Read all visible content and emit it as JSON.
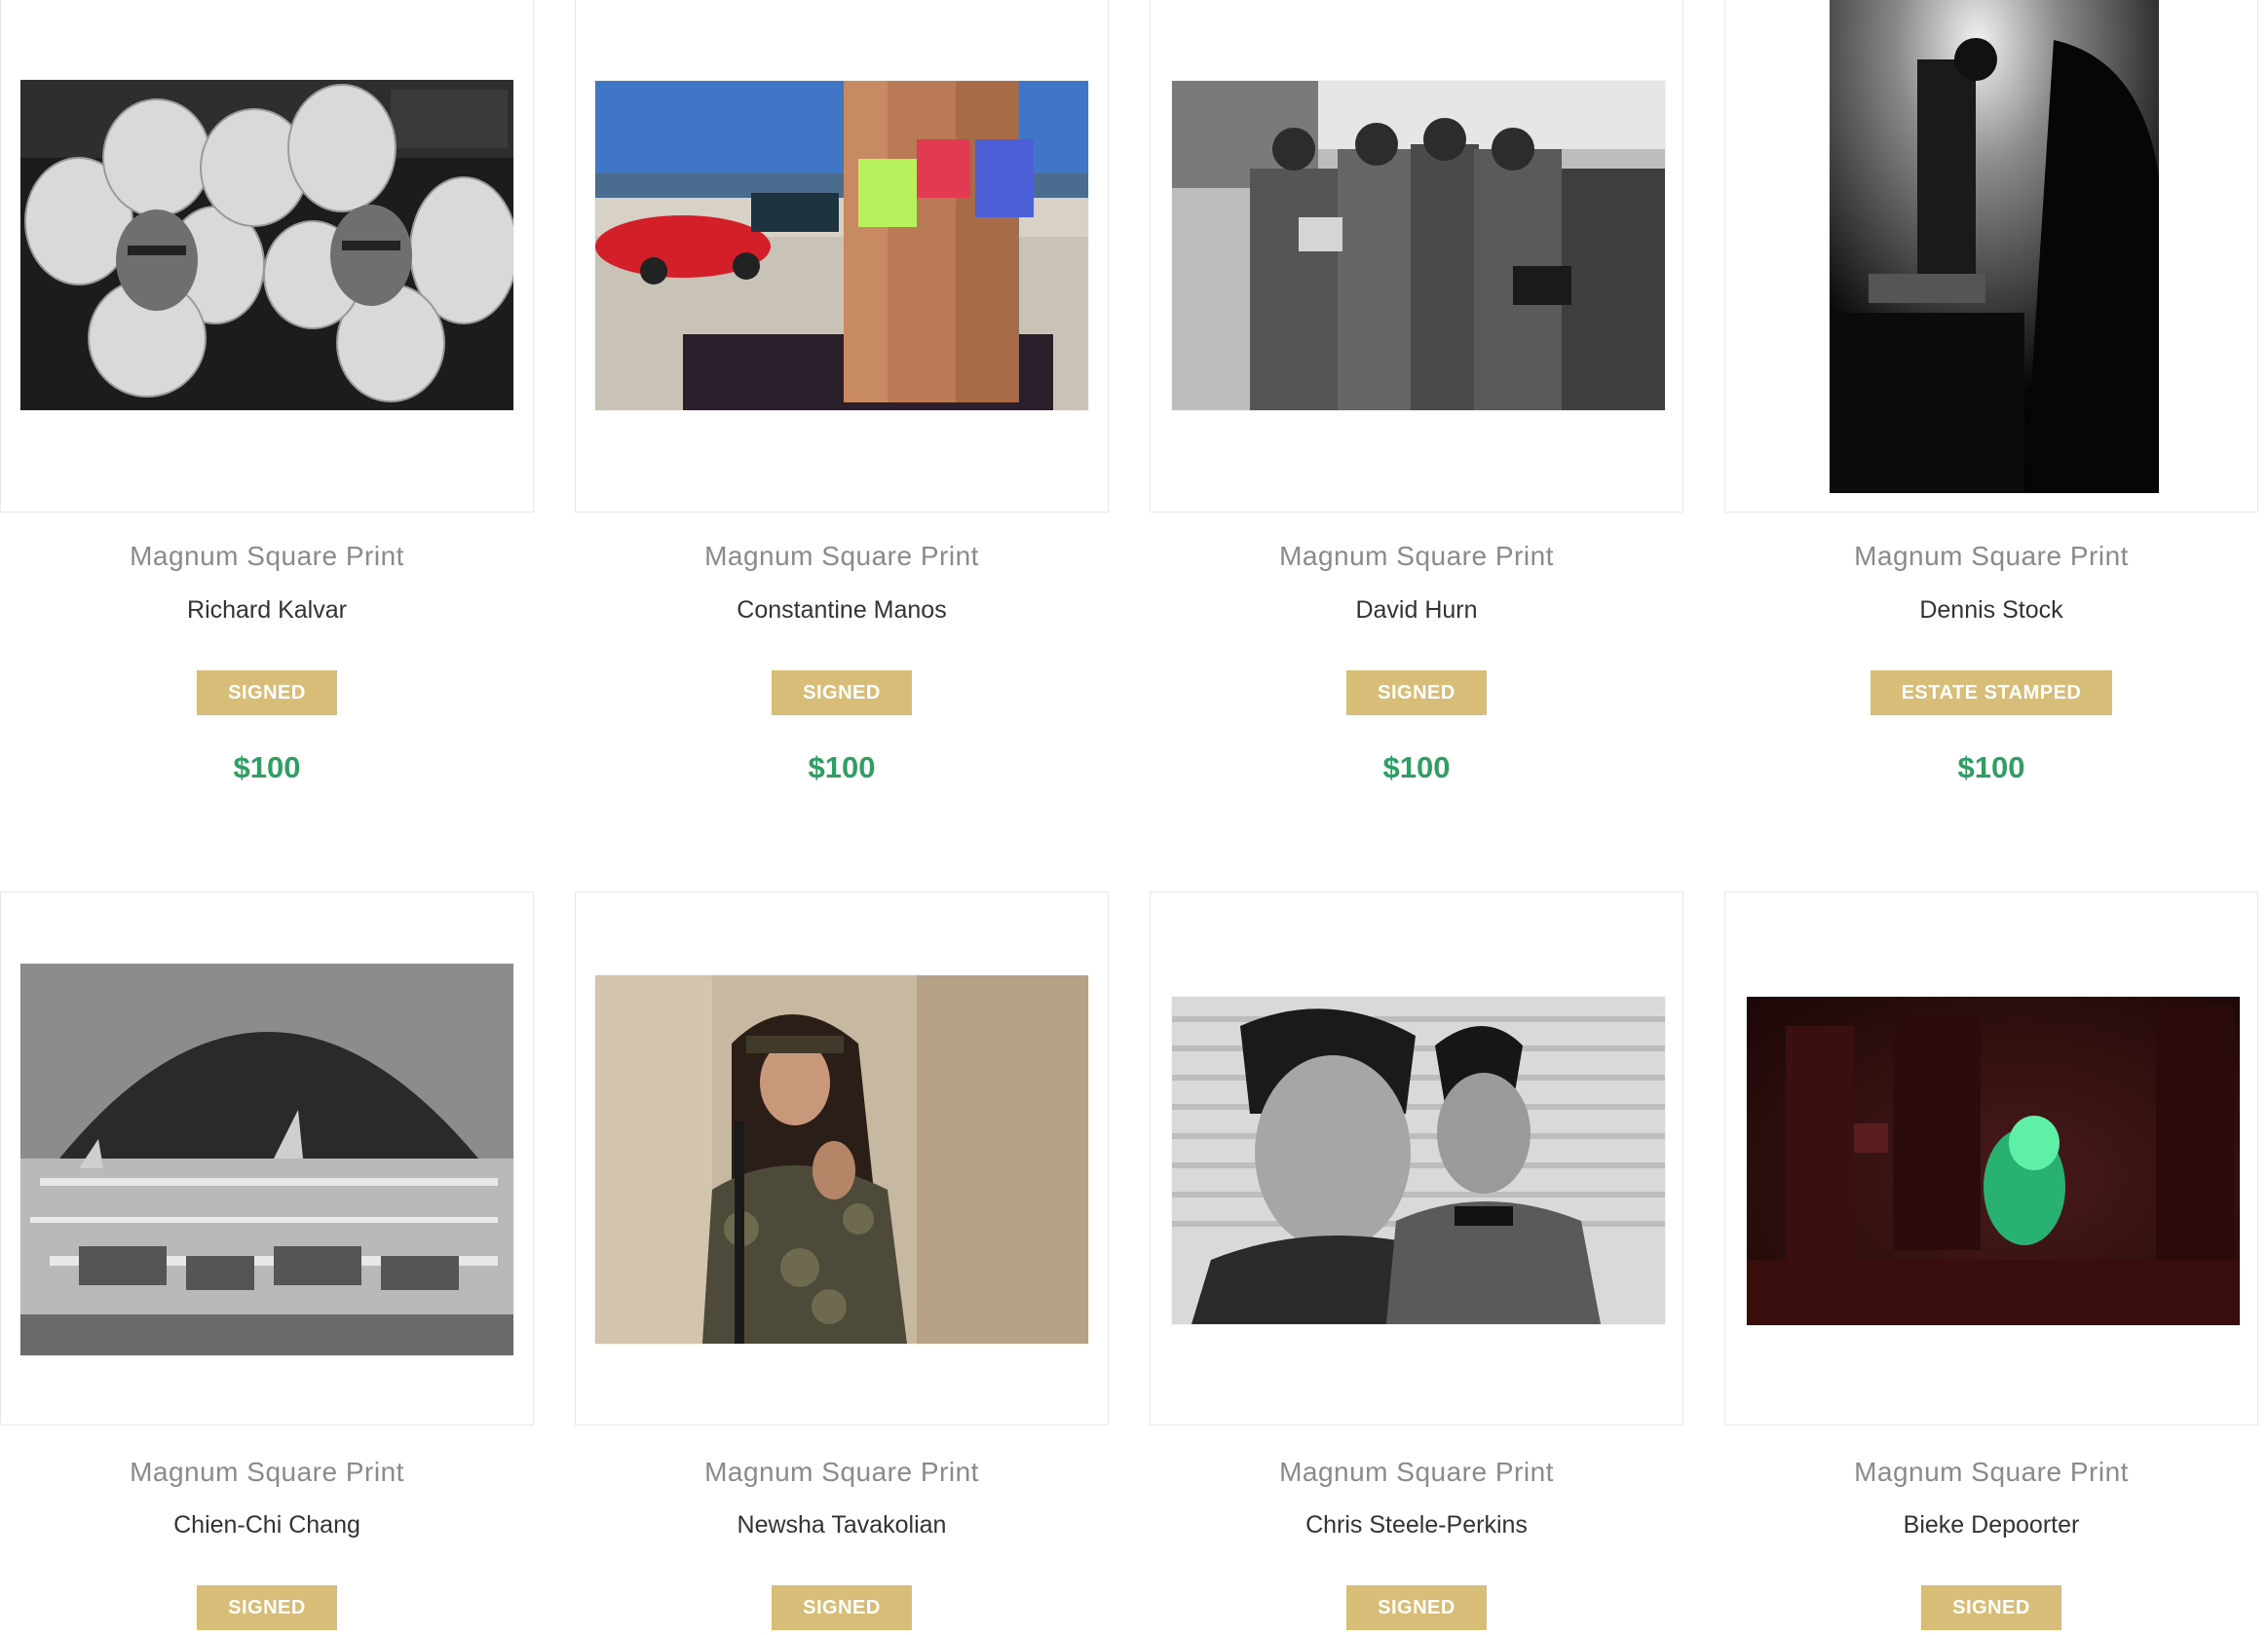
{
  "products": [
    {
      "type": "Magnum Square Print",
      "artist": "Richard Kalvar",
      "badge": "SIGNED",
      "price": "$100"
    },
    {
      "type": "Magnum Square Print",
      "artist": "Constantine Manos",
      "badge": "SIGNED",
      "price": "$100"
    },
    {
      "type": "Magnum Square Print",
      "artist": "David Hurn",
      "badge": "SIGNED",
      "price": "$100"
    },
    {
      "type": "Magnum Square Print",
      "artist": "Dennis Stock",
      "badge": "ESTATE STAMPED",
      "price": "$100"
    },
    {
      "type": "Magnum Square Print",
      "artist": "Chien-Chi Chang",
      "badge": "SIGNED",
      "price": ""
    },
    {
      "type": "Magnum Square Print",
      "artist": "Newsha Tavakolian",
      "badge": "SIGNED",
      "price": ""
    },
    {
      "type": "Magnum Square Print",
      "artist": "Chris Steele-Perkins",
      "badge": "SIGNED",
      "price": ""
    },
    {
      "type": "Magnum Square Print",
      "artist": "Bieke Depoorter",
      "badge": "SIGNED",
      "price": ""
    }
  ],
  "colors": {
    "badge": "#d7bd78",
    "price": "#2e9f63",
    "card_border": "#e8e8e8"
  }
}
